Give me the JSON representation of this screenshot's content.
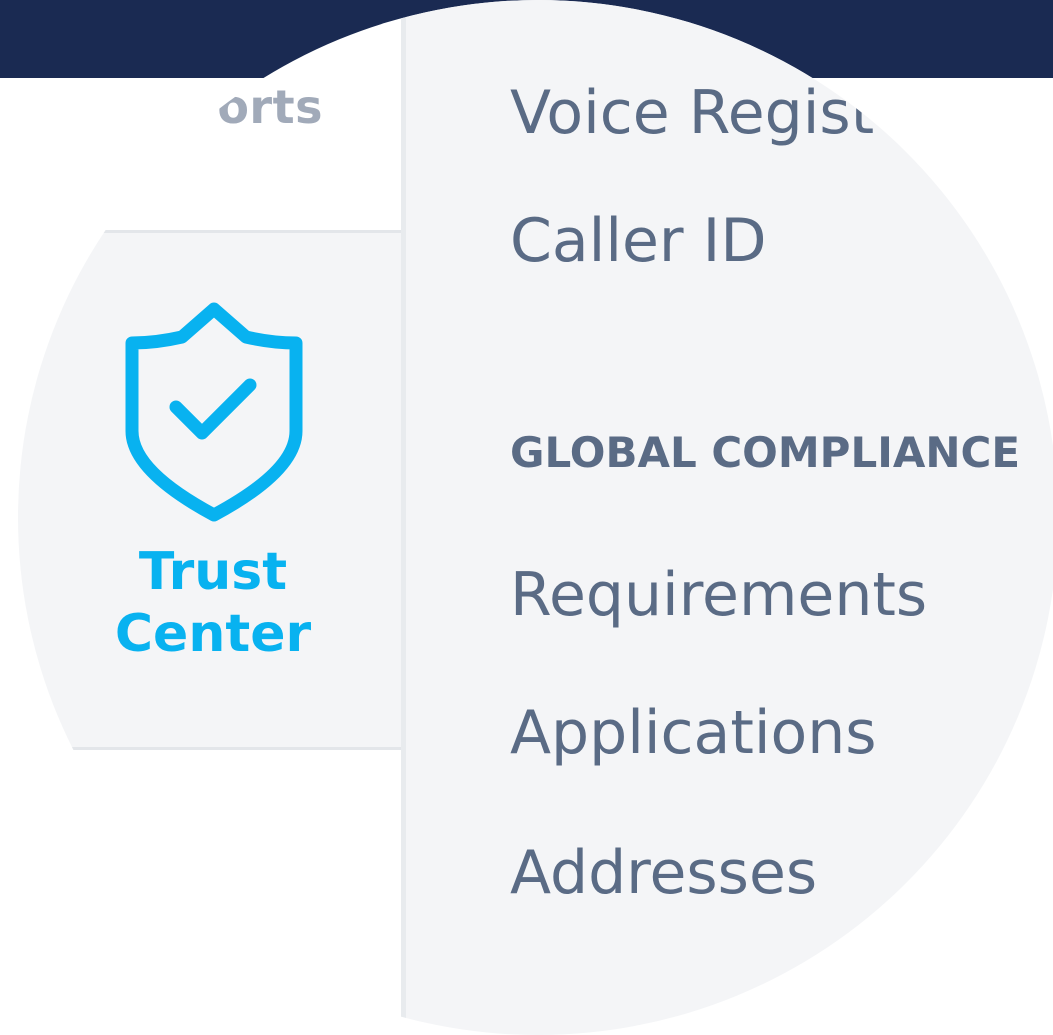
{
  "header": {
    "bar_color": "#1a2a52"
  },
  "sidebar": {
    "partial_item_label": "orts",
    "active_item": {
      "icon": "shield-check-icon",
      "label_line1": "Trust",
      "label_line2": "Center",
      "accent_color": "#08b2f0"
    }
  },
  "submenu": {
    "items_top": [
      {
        "label": "Voice Regist"
      },
      {
        "label": "Caller ID"
      }
    ],
    "section_heading": "GLOBAL COMPLIANCE",
    "items_section": [
      {
        "label": "Requirements"
      },
      {
        "label": "Applications"
      },
      {
        "label": "Addresses"
      }
    ],
    "text_color": "#5a6b85",
    "background_color": "#f4f5f7"
  }
}
